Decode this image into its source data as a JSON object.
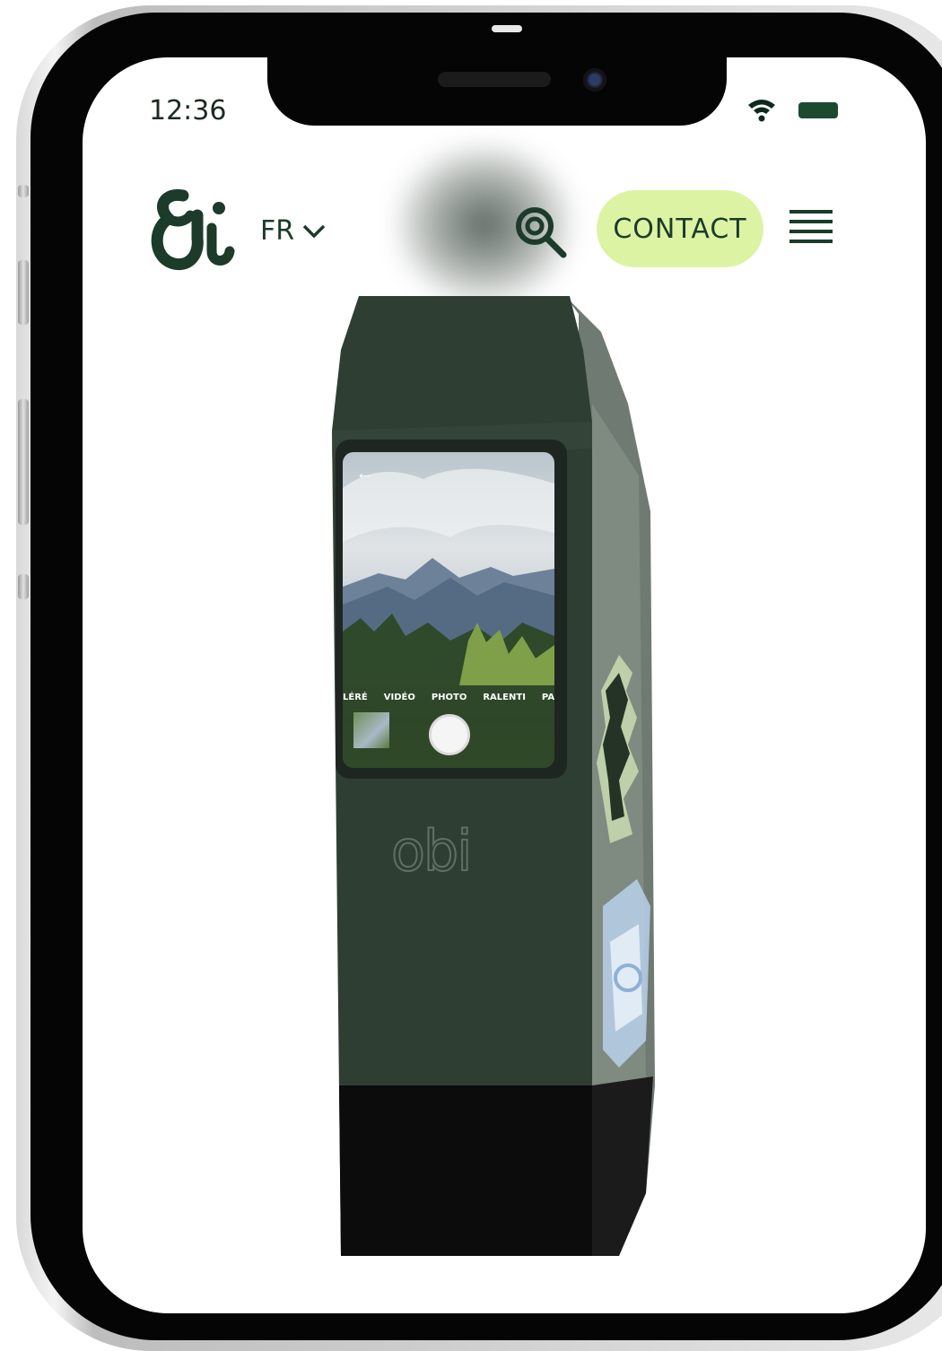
{
  "status_bar": {
    "time": "12:36",
    "icons": [
      "wifi-icon",
      "battery-icon"
    ]
  },
  "header": {
    "logo": "brand-logo",
    "language": "FR",
    "search_icon": "search-icon",
    "contact_label": "CONTACT",
    "menu_icon": "hamburger-menu-icon"
  },
  "product": {
    "brand_mark": "obi",
    "camera_screen": {
      "back_icon": "←",
      "modes": [
        "LÉRÉ",
        "VIDÉO",
        "PHOTO",
        "RALENTI",
        "PAI"
      ],
      "active_mode": "PHOTO"
    }
  },
  "colors": {
    "brand_green": "#1c3b2a",
    "contact_bg": "#ddf3a4",
    "product_body": "#2f3e33"
  }
}
